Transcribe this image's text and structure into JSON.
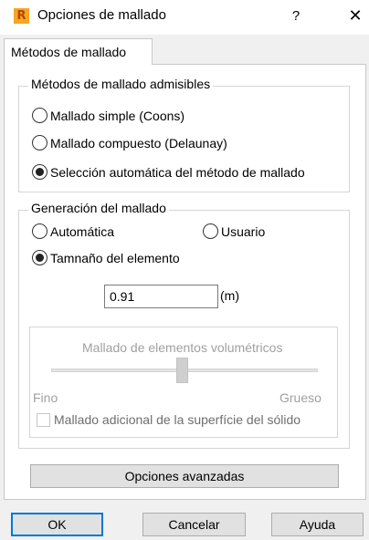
{
  "window": {
    "title": "Opciones de mallado",
    "help_label": "?",
    "close_label": "✕",
    "app_icon_letter": "R",
    "app_icon_color": "#f5a623"
  },
  "tabs": [
    {
      "label": "Métodos de mallado",
      "active": true
    }
  ],
  "methods_group": {
    "title": "Métodos de mallado admisibles",
    "options": [
      {
        "label": "Mallado simple (Coons)",
        "selected": false
      },
      {
        "label": "Mallado compuesto (Delaunay)",
        "selected": false
      },
      {
        "label": "Selección automática del método de mallado",
        "selected": true
      }
    ]
  },
  "generation_group": {
    "title": "Generación del mallado",
    "options": [
      {
        "label": "Automática",
        "selected": false
      },
      {
        "label": "Usuario",
        "selected": false
      },
      {
        "label": "Tamnaño del elemento",
        "selected": true
      }
    ],
    "element_size_value": "0.91",
    "element_size_unit": "(m)"
  },
  "volumetric": {
    "title": "Mallado de elementos volumétricos",
    "min_label": "Fino",
    "max_label": "Grueso",
    "slider_level": 0.5,
    "enabled": false,
    "checkbox_label": "Mallado adicional de la superfície del sólido",
    "checkbox_checked": false
  },
  "buttons": {
    "advanced": "Opciones avanzadas",
    "ok": "OK",
    "cancel": "Cancelar",
    "help": "Ayuda"
  }
}
